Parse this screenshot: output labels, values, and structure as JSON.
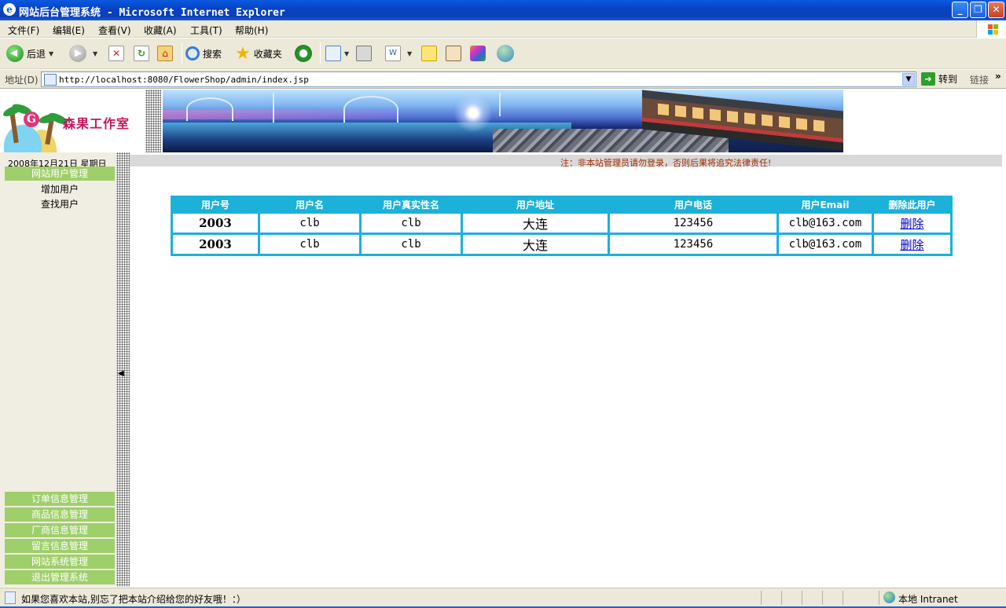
{
  "window": {
    "title": "网站后台管理系统 - Microsoft Internet Explorer",
    "controls": {
      "minimize": "_",
      "maximize": "❐",
      "close": "✕"
    }
  },
  "menu": [
    "文件(F)",
    "编辑(E)",
    "查看(V)",
    "收藏(A)",
    "工具(T)",
    "帮助(H)"
  ],
  "toolbar": {
    "back_label": "后退",
    "search_label": "搜索",
    "favorites_label": "收藏夹"
  },
  "address": {
    "label": "地址(D)",
    "url": "http://localhost:8080/FlowerShop/admin/index.jsp",
    "go_label": "转到",
    "links_label": "链接"
  },
  "site": {
    "logo_text": "森果工作室",
    "logo_letter": "G",
    "date": "2008年12月21日 星期日",
    "notice": "注：非本站管理员请勿登录，否则后果将追究法律责任!"
  },
  "sidebar": {
    "top_section": "网站用户管理",
    "sub_items": [
      "增加用户",
      "查找用户"
    ],
    "bottom_sections": [
      "订单信息管理",
      "商品信息管理",
      "厂商信息管理",
      "留言信息管理",
      "网站系统管理",
      "退出管理系统"
    ]
  },
  "user_table": {
    "headers": [
      "用户号",
      "用户名",
      "用户真实性名",
      "用户地址",
      "用户电话",
      "用户Email",
      "删除此用户"
    ],
    "rows": [
      {
        "id": "2003",
        "name": "clb",
        "real_name": "clb",
        "address": "大连",
        "phone": "123456",
        "email": "clb@163.com",
        "action": "删除"
      },
      {
        "id": "2003",
        "name": "clb",
        "real_name": "clb",
        "address": "大连",
        "phone": "123456",
        "email": "clb@163.com",
        "action": "删除"
      }
    ]
  },
  "status": {
    "text": "如果您喜欢本站,别忘了把本站介绍给您的好友哦！：）",
    "zone": "本地 Intranet"
  },
  "colors": {
    "table_border": "#1bb1d9",
    "sidebar_header": "#9fcf6a",
    "notice_text": "#a52a00",
    "titlebar": "#0a3fb8"
  }
}
